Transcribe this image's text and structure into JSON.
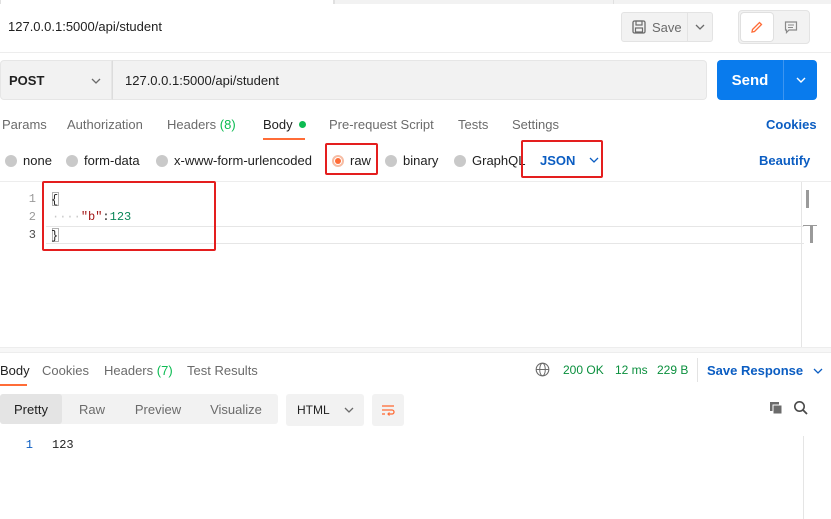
{
  "request": {
    "title": "127.0.0.1:5000/api/student",
    "save_label": "Save",
    "method": "POST",
    "url": "127.0.0.1:5000/api/student",
    "send_label": "Send"
  },
  "request_tabs": {
    "params": "Params",
    "authorization": "Authorization",
    "headers": "Headers",
    "headers_count": "(8)",
    "body": "Body",
    "pre_request_script": "Pre-request Script",
    "tests": "Tests",
    "settings": "Settings",
    "cookies": "Cookies"
  },
  "body_types": {
    "none": "none",
    "form_data": "form-data",
    "urlencoded": "x-www-form-urlencoded",
    "raw": "raw",
    "binary": "binary",
    "graphql": "GraphQL",
    "selected": "raw",
    "raw_format": "JSON",
    "beautify": "Beautify"
  },
  "editor": {
    "line_numbers": [
      "1",
      "2",
      "3"
    ],
    "line1": "{",
    "line2_indent": "····",
    "line2_key": "\"b\"",
    "line2_colon": ":",
    "line2_value": "123",
    "line3": "}"
  },
  "response": {
    "tabs": {
      "body": "Body",
      "cookies": "Cookies",
      "headers": "Headers",
      "headers_count": "(7)",
      "test_results": "Test Results"
    },
    "status": "200 OK",
    "time": "12 ms",
    "size": "229 B",
    "save_response": "Save Response",
    "views": [
      "Pretty",
      "Raw",
      "Preview",
      "Visualize"
    ],
    "active_view": "Pretty",
    "format": "HTML",
    "line_number": "1",
    "body": "123"
  },
  "colors": {
    "accent_orange": "#ff6c37",
    "send_blue": "#097bed",
    "link_blue": "#0b5dc2",
    "success_green": "#0cbb52",
    "highlight_red": "#e41e1e"
  }
}
